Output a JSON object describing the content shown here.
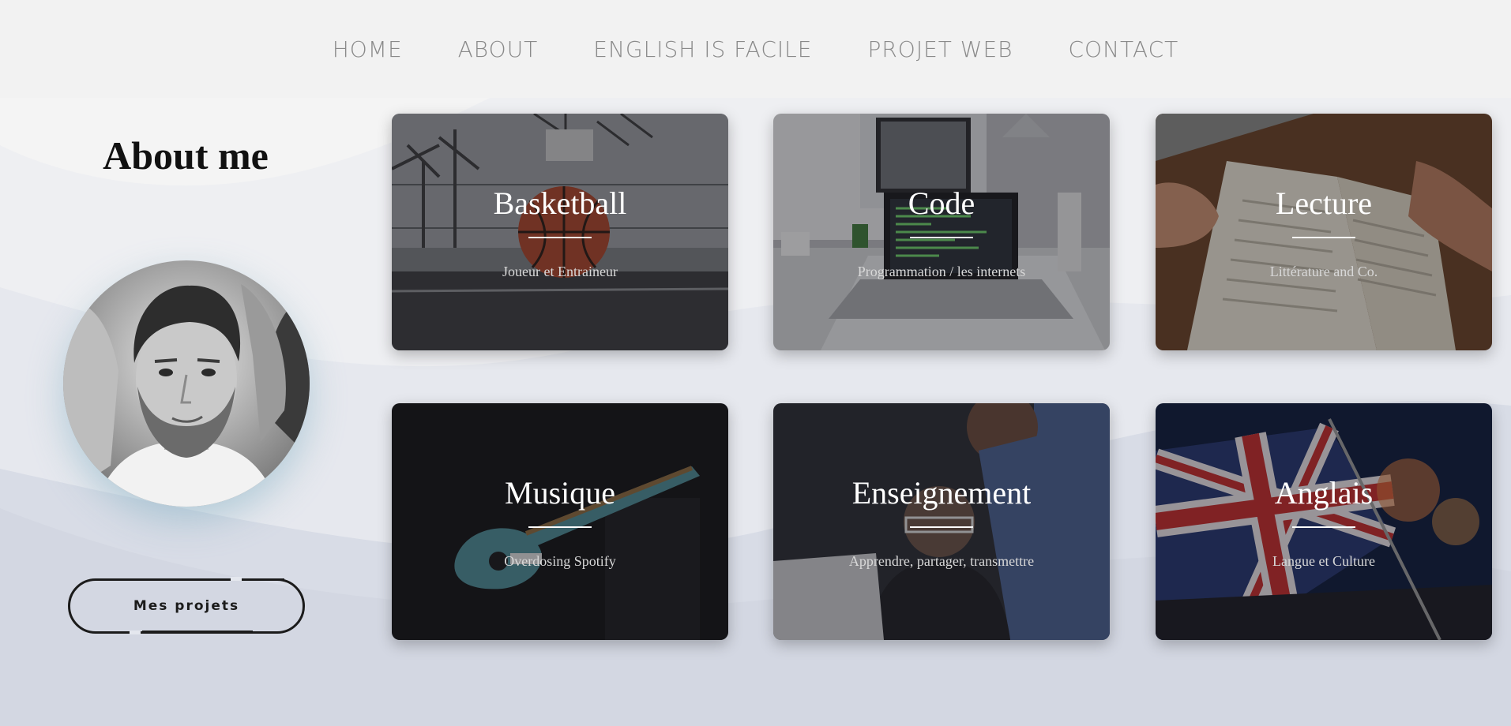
{
  "nav": {
    "items": [
      {
        "label": "HOME"
      },
      {
        "label": "ABOUT"
      },
      {
        "label": "ENGLISH IS FACILE"
      },
      {
        "label": "PROJET WEB"
      },
      {
        "label": "CONTACT"
      }
    ]
  },
  "about": {
    "title": "About me",
    "button_label": "Mes projets"
  },
  "cards": [
    {
      "title": "Basketball",
      "subtitle": "Joueur et Entraineur"
    },
    {
      "title": "Code",
      "subtitle": "Programmation / les internets"
    },
    {
      "title": "Lecture",
      "subtitle": "Littérature and Co."
    },
    {
      "title": "Musique",
      "subtitle": "Overdosing Spotify"
    },
    {
      "title": "Enseignement",
      "subtitle": "Apprendre, partager, transmettre"
    },
    {
      "title": "Anglais",
      "subtitle": "Langue et Culture"
    }
  ],
  "colors": {
    "nav_background": "#f2f2f2",
    "nav_text": "#8a8a8a",
    "page_background": "#dde0e8",
    "heading": "#111111",
    "button_border": "#1b1b1b"
  }
}
